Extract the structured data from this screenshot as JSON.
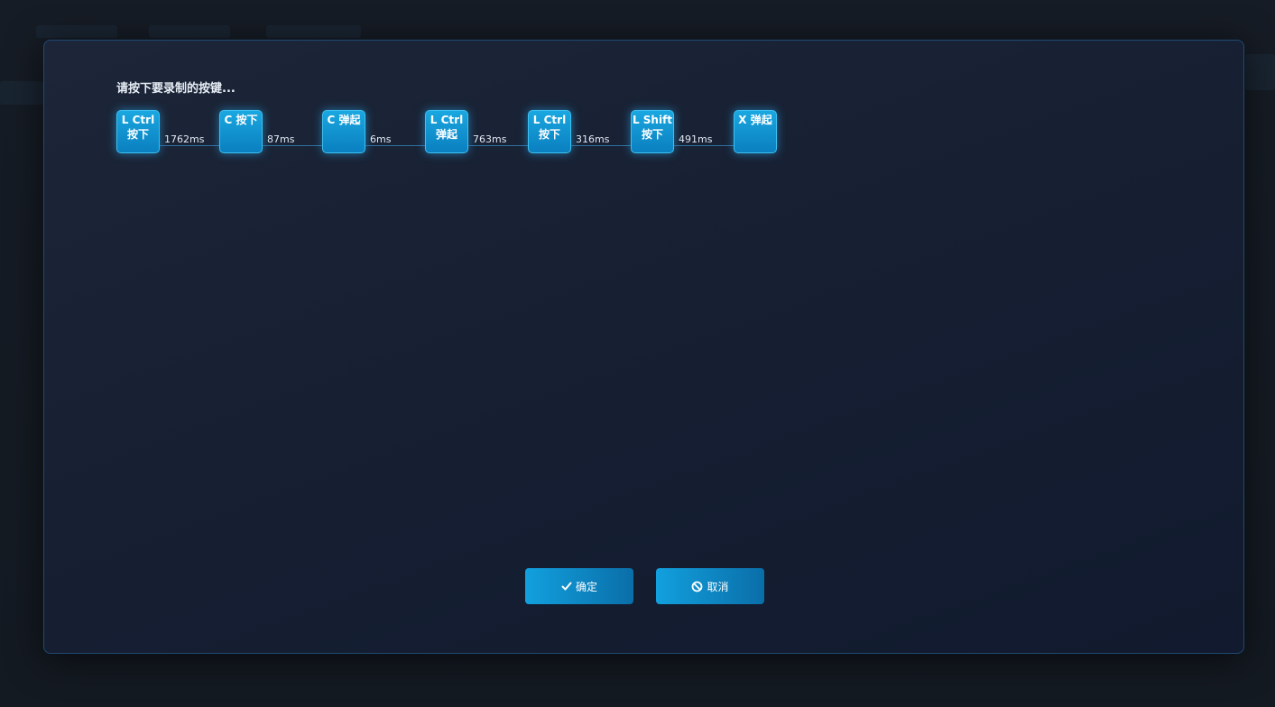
{
  "dialog": {
    "prompt": "请按下要录制的按键...",
    "keys": [
      {
        "line1": "L Ctrl",
        "line2": "按下"
      },
      {
        "line1": "C 按下",
        "line2": ""
      },
      {
        "line1": "C 弹起",
        "line2": ""
      },
      {
        "line1": "L Ctrl",
        "line2": "弹起"
      },
      {
        "line1": "L Ctrl",
        "line2": "按下"
      },
      {
        "line1": "L Shift",
        "line2": "按下"
      },
      {
        "line1": "X 弹起",
        "line2": ""
      }
    ],
    "intervals": [
      "1762ms",
      "87ms",
      "6ms",
      "763ms",
      "316ms",
      "491ms"
    ],
    "confirm": {
      "label": "确定",
      "icon": "check-icon"
    },
    "cancel": {
      "label": "取消",
      "icon": "ban-icon"
    }
  },
  "colors": {
    "accent": "#12a0de",
    "key_border": "#3fc0f0",
    "modal_border": "#1f4a73"
  }
}
